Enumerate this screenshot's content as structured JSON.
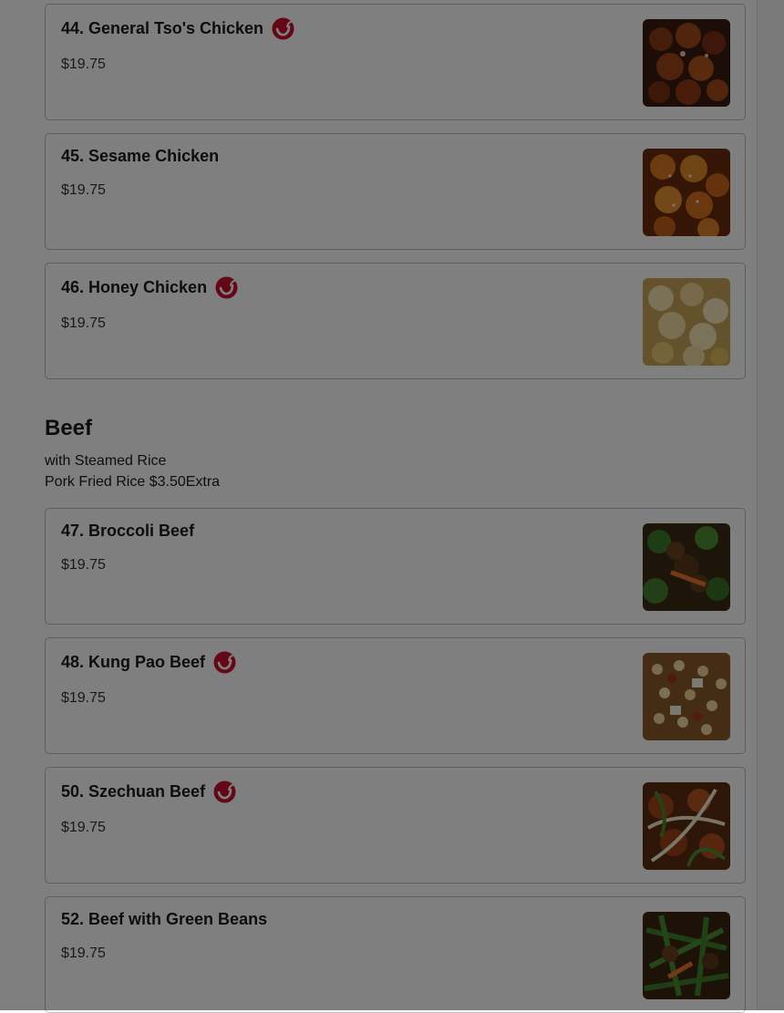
{
  "items": [
    {
      "name": "44. General Tso's Chicken",
      "price": "$19.75",
      "spicy": true
    },
    {
      "name": "45. Sesame Chicken",
      "price": "$19.75",
      "spicy": false
    },
    {
      "name": "46. Honey Chicken",
      "price": "$19.75",
      "spicy": true
    },
    {
      "name": "47. Broccoli Beef",
      "price": "$19.75",
      "spicy": false
    },
    {
      "name": "48. Kung Pao Beef",
      "price": "$19.75",
      "spicy": true
    },
    {
      "name": "50. Szechuan Beef",
      "price": "$19.75",
      "spicy": true
    },
    {
      "name": "52. Beef with Green Beans",
      "price": "$19.75",
      "spicy": false
    }
  ],
  "beef_section": {
    "title": "Beef",
    "line1": "with Steamed Rice",
    "line2": "Pork Fried Rice $3.50Extra"
  },
  "colors": {
    "spicy_badge": "#c8102e",
    "card_border": "#bdbdbd",
    "overlay": "rgba(0,0,0,0.5)"
  },
  "icons": {
    "spicy": "chili-pepper-icon"
  }
}
